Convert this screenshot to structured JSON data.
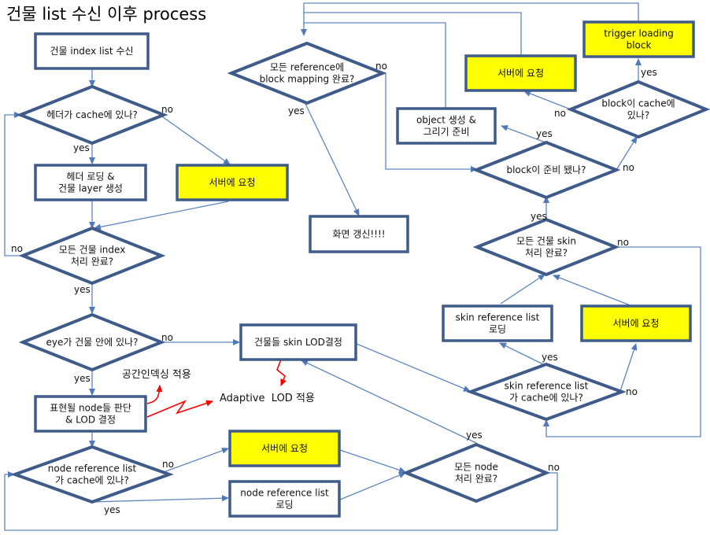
{
  "title": "건물 list 수신 이후 process",
  "colors": {
    "box_border": "#3e5b89",
    "edge": "#5f86bf",
    "highlight_fill": "#ffff00",
    "annotation_arrow": "#ff0000"
  },
  "nodes": {
    "receive_index": {
      "type": "process",
      "lines": [
        "건물 index list 수신"
      ]
    },
    "header_cached": {
      "type": "decision",
      "lines": [
        "헤더가 cache에 있나?"
      ]
    },
    "header_load": {
      "type": "process",
      "lines": [
        "헤더 로딩 &",
        "건물 layer 생성"
      ]
    },
    "server_req_1": {
      "type": "process-highlight",
      "lines": [
        "서버에 요청"
      ]
    },
    "all_index_done": {
      "type": "decision",
      "lines": [
        "모든 건물 index",
        "처리 완료?"
      ]
    },
    "eye_inside": {
      "type": "decision",
      "lines": [
        "eye가 건물 안에 있나?"
      ]
    },
    "decide_nodes": {
      "type": "process",
      "lines": [
        "표현될 node들 판단",
        "& LOD 결정"
      ]
    },
    "node_ref_cached": {
      "type": "decision",
      "lines": [
        "node reference list",
        "가 cache에 있나?"
      ]
    },
    "server_req_2": {
      "type": "process-highlight",
      "lines": [
        "서버에 요청"
      ]
    },
    "node_ref_load": {
      "type": "process",
      "lines": [
        "node reference list",
        "로딩"
      ]
    },
    "all_node_done": {
      "type": "decision",
      "lines": [
        "모든 node",
        "처리 완료?"
      ]
    },
    "skin_lod": {
      "type": "process",
      "lines": [
        "건물들 skin LOD결정"
      ]
    },
    "skin_ref_cached": {
      "type": "decision",
      "lines": [
        "skin reference list",
        "가 cache에 있나?"
      ]
    },
    "skin_ref_load": {
      "type": "process",
      "lines": [
        "skin reference list",
        "로딩"
      ]
    },
    "server_req_3": {
      "type": "process-highlight",
      "lines": [
        "서버에 요청"
      ]
    },
    "all_skin_done": {
      "type": "decision",
      "lines": [
        "모든 건물 skin",
        "처리 완료?"
      ]
    },
    "block_ready": {
      "type": "decision",
      "lines": [
        "block이 준비 됐나?"
      ]
    },
    "object_create": {
      "type": "process",
      "lines": [
        "object 생성 &",
        "그리기 준비"
      ]
    },
    "block_cached": {
      "type": "decision",
      "lines": [
        "block이 cache에",
        "있나?"
      ]
    },
    "server_req_4": {
      "type": "process-highlight",
      "lines": [
        "서버에 요청"
      ]
    },
    "trigger_loading": {
      "type": "process-highlight",
      "lines": [
        "trigger loading",
        "block"
      ]
    },
    "all_ref_mapped": {
      "type": "decision",
      "lines": [
        "모든 reference에",
        "block mapping 완료?"
      ]
    },
    "refresh": {
      "type": "process",
      "lines": [
        "화면 갱신!!!!"
      ]
    }
  },
  "edge_labels": {
    "yes": "yes",
    "no": "no"
  },
  "annotations": {
    "spatial_indexing": "공간인덱싱 적용",
    "adaptive_lod": "Adaptive  LOD 적용"
  },
  "edges": [
    {
      "from": "receive_index",
      "to": "header_cached"
    },
    {
      "from": "header_cached",
      "to": "header_load",
      "label": "yes"
    },
    {
      "from": "header_cached",
      "to": "server_req_1",
      "label": "no"
    },
    {
      "from": "header_load",
      "to": "all_index_done"
    },
    {
      "from": "server_req_1",
      "to": "all_index_done"
    },
    {
      "from": "all_index_done",
      "to": "header_cached",
      "label": "no"
    },
    {
      "from": "all_index_done",
      "to": "eye_inside",
      "label": "yes"
    },
    {
      "from": "eye_inside",
      "to": "decide_nodes",
      "label": "yes"
    },
    {
      "from": "eye_inside",
      "to": "skin_lod",
      "label": "no"
    },
    {
      "from": "decide_nodes",
      "to": "node_ref_cached"
    },
    {
      "from": "node_ref_cached",
      "to": "server_req_2",
      "label": "no"
    },
    {
      "from": "node_ref_cached",
      "to": "node_ref_load",
      "label": "yes"
    },
    {
      "from": "server_req_2",
      "to": "all_node_done"
    },
    {
      "from": "node_ref_load",
      "to": "all_node_done"
    },
    {
      "from": "all_node_done",
      "to": "node_ref_cached",
      "label": "no"
    },
    {
      "from": "all_node_done",
      "to": "skin_lod",
      "label": "yes"
    },
    {
      "from": "skin_lod",
      "to": "skin_ref_cached"
    },
    {
      "from": "skin_ref_cached",
      "to": "skin_ref_load",
      "label": "yes"
    },
    {
      "from": "skin_ref_cached",
      "to": "server_req_3",
      "label": "no"
    },
    {
      "from": "skin_ref_load",
      "to": "all_skin_done"
    },
    {
      "from": "server_req_3",
      "to": "all_skin_done"
    },
    {
      "from": "all_skin_done",
      "to": "skin_ref_cached",
      "label": "no"
    },
    {
      "from": "all_skin_done",
      "to": "block_ready",
      "label": "yes"
    },
    {
      "from": "block_ready",
      "to": "object_create",
      "label": "yes"
    },
    {
      "from": "block_ready",
      "to": "block_cached",
      "label": "no"
    },
    {
      "from": "block_cached",
      "to": "server_req_4",
      "label": "no"
    },
    {
      "from": "block_cached",
      "to": "trigger_loading",
      "label": "yes"
    },
    {
      "from": "object_create",
      "to": "all_ref_mapped"
    },
    {
      "from": "server_req_4",
      "to": "all_ref_mapped"
    },
    {
      "from": "trigger_loading",
      "to": "all_ref_mapped"
    },
    {
      "from": "all_ref_mapped",
      "to": "block_ready",
      "label": "no"
    },
    {
      "from": "all_ref_mapped",
      "to": "refresh",
      "label": "yes"
    }
  ]
}
